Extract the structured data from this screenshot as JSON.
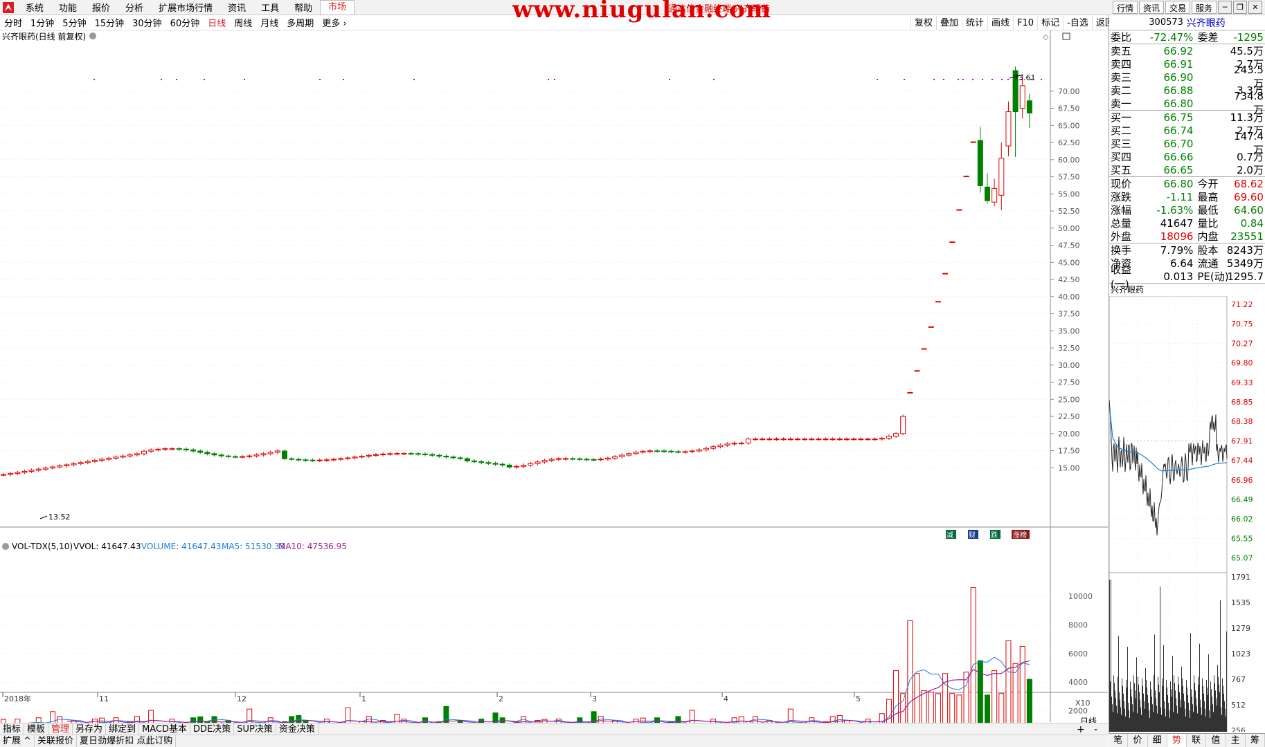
{
  "menu": {
    "items": [
      "系统",
      "功能",
      "报价",
      "分析",
      "扩展市场行情",
      "资讯",
      "工具",
      "帮助"
    ],
    "active_item": "市场",
    "watermark": "www.niugulan.com",
    "subtitle": "通达信金融终端 兴齐眼药",
    "right_buttons": [
      "行情",
      "资讯",
      "交易",
      "服务"
    ]
  },
  "periods": {
    "items": [
      "分时",
      "1分钟",
      "5分钟",
      "15分钟",
      "30分钟",
      "60分钟",
      "日线",
      "周线",
      "月线",
      "多周期",
      "更多"
    ],
    "active": "日线"
  },
  "toolbar_right": [
    "复权",
    "叠加",
    "统计",
    "画线",
    "F10",
    "标记",
    "-自选",
    "返回"
  ],
  "kline": {
    "title": "兴齐眼药(日线 前复权)",
    "high_label": "73.61",
    "low_label": "13.52",
    "price_ticks": [
      "70.00",
      "67.50",
      "65.00",
      "62.50",
      "60.00",
      "57.50",
      "55.00",
      "52.50",
      "50.00",
      "47.50",
      "45.00",
      "42.50",
      "40.00",
      "37.50",
      "35.00",
      "32.50",
      "30.00",
      "27.50",
      "25.00",
      "22.50",
      "20.00",
      "17.50",
      "15.00"
    ],
    "badges": [
      "减",
      "财",
      "跌",
      "涨榜"
    ]
  },
  "volume_panel": {
    "name": "VOL-TDX(5,10)",
    "vvol": "VVOL: 41647.43",
    "volume": "VOLUME: 41647.43",
    "ma5": "MA5: 51530.33",
    "ma10": "MA10: 47536.95",
    "ticks": [
      "10000",
      "8000",
      "6000",
      "4000",
      "2000"
    ],
    "scale_label": "X10"
  },
  "time_axis": {
    "labels": [
      "2018年",
      "11",
      "12",
      "1",
      "2",
      "3",
      "4",
      "5"
    ],
    "period_label": "日线"
  },
  "bottom_tabs": [
    "指标",
    "模板",
    "管理",
    "另存为",
    "绑定到",
    "MACD基本",
    "DDE决策",
    "SUP决策",
    "资金决策"
  ],
  "bottom_active": "管理",
  "status": [
    "扩展",
    "关联报价",
    "夏日劲爆折扣 点此订购"
  ],
  "quote": {
    "code": "300573",
    "name": "兴齐眼药",
    "weibi_label": "委比",
    "weibi": "-72.47%",
    "weicha_label": "委差",
    "weicha": "-1295",
    "asks": [
      {
        "label": "卖五",
        "price": "66.92",
        "vol": "45.5万"
      },
      {
        "label": "卖四",
        "price": "66.91",
        "vol": "2.7万"
      },
      {
        "label": "卖三",
        "price": "66.90",
        "vol": "243.5万"
      },
      {
        "label": "卖二",
        "price": "66.88",
        "vol": "3.3万"
      },
      {
        "label": "卖一",
        "price": "66.80",
        "vol": "734.8万"
      }
    ],
    "bids": [
      {
        "label": "买一",
        "price": "66.75",
        "vol": "11.3万"
      },
      {
        "label": "买二",
        "price": "66.74",
        "vol": "2.7万"
      },
      {
        "label": "买三",
        "price": "66.70",
        "vol": "147.4万"
      },
      {
        "label": "买四",
        "price": "66.66",
        "vol": "0.7万"
      },
      {
        "label": "买五",
        "price": "66.65",
        "vol": "2.0万"
      }
    ],
    "stats": [
      {
        "l1": "现价",
        "v1": "66.80",
        "c1": "green",
        "l2": "今开",
        "v2": "68.62",
        "c2": "red"
      },
      {
        "l1": "涨跌",
        "v1": "-1.11",
        "c1": "green",
        "l2": "最高",
        "v2": "69.60",
        "c2": "red"
      },
      {
        "l1": "涨幅",
        "v1": "-1.63%",
        "c1": "green",
        "l2": "最低",
        "v2": "64.60",
        "c2": "green"
      },
      {
        "l1": "总量",
        "v1": "41647",
        "c1": "",
        "l2": "量比",
        "v2": "0.84",
        "c2": "green"
      },
      {
        "l1": "外盘",
        "v1": "18096",
        "c1": "red",
        "l2": "内盘",
        "v2": "23551",
        "c2": "green"
      }
    ],
    "stats2": [
      {
        "l1": "换手",
        "v1": "7.79%",
        "l2": "股本",
        "v2": "8243万"
      },
      {
        "l1": "净资",
        "v1": "6.64",
        "l2": "流通",
        "v2": "5349万"
      },
      {
        "l1": "收益(一)",
        "v1": "0.013",
        "l2": "PE(动)",
        "v2": "1295.7"
      }
    ]
  },
  "intraday": {
    "title": "兴齐眼药",
    "price_ticks": [
      "71.22",
      "70.75",
      "70.27",
      "69.80",
      "69.33",
      "68.85",
      "68.38",
      "67.91",
      "67.44",
      "66.96",
      "66.49",
      "66.02",
      "65.55",
      "65.07"
    ],
    "vol_ticks": [
      "1791",
      "1535",
      "1279",
      "1023",
      "767",
      "512",
      "256"
    ],
    "tabs": [
      "笔",
      "价",
      "细",
      "势",
      "联",
      "值",
      "主",
      "筹"
    ],
    "active_tab": "势"
  },
  "colors": {
    "up": "#e00000",
    "down": "#008000",
    "ma5": "#1a7fd4",
    "ma10": "#9b1f8f"
  }
}
